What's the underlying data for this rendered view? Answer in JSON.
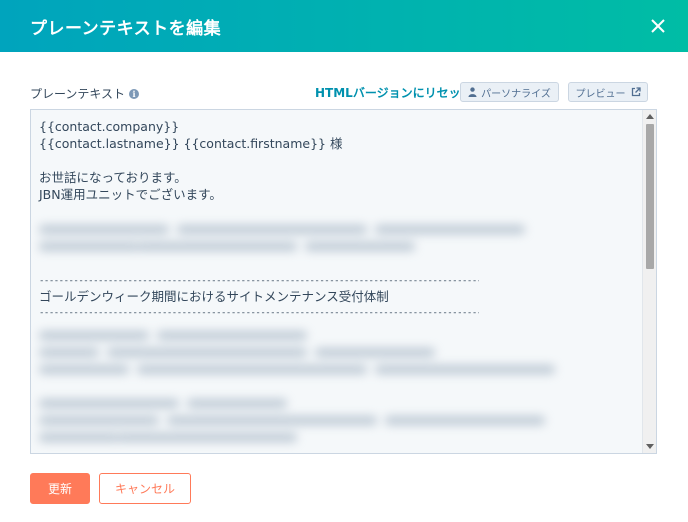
{
  "header": {
    "title": "プレーンテキストを編集",
    "close_icon": "close-icon"
  },
  "toolbar": {
    "field_label": "プレーンテキスト",
    "info_icon": "info-icon",
    "reset_link": "HTMLバージョンにリセット",
    "personalize_label": "パーソナライズ",
    "personalize_icon": "person-icon",
    "preview_label": "プレビュー",
    "preview_icon": "external-link-icon"
  },
  "editor": {
    "lines": {
      "company": "{{contact.company}}",
      "name": "{{contact.lastname}} {{contact.firstname}} 様",
      "greeting": "お世話になっております。",
      "team": "JBN運用ユニットでございます。",
      "divider_top": "--------------------------------------------------------------------------------------------------------------",
      "heading": "ゴールデンウィーク期間におけるサイトメンテナンス受付体制",
      "divider_bottom": "--------------------------------------------------------------------------------------------------------------"
    }
  },
  "footer": {
    "update_label": "更新",
    "cancel_label": "キャンセル"
  },
  "colors": {
    "header_gradient_start": "#00a4bd",
    "header_gradient_end": "#00bda5",
    "accent_link": "#0091ae",
    "primary_button": "#ff7a59"
  }
}
